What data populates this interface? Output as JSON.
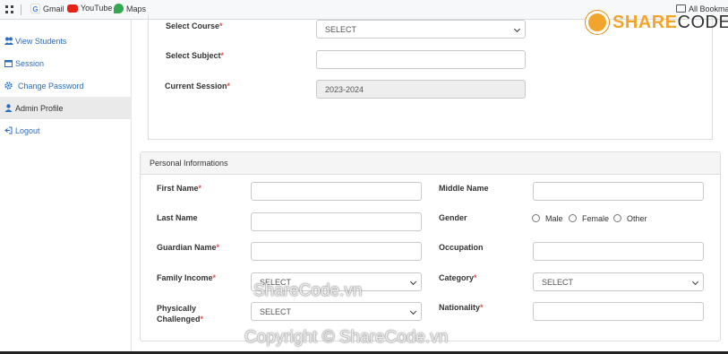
{
  "bookmarks": {
    "items": [
      {
        "label": "Gmail",
        "icon": "google-icon"
      },
      {
        "label": "YouTube",
        "icon": "youtube-icon"
      },
      {
        "label": "Maps",
        "icon": "maps-icon"
      }
    ],
    "all_label": "All Bookmark"
  },
  "logo": {
    "part1": "SHARE",
    "part2": "CODE.vn"
  },
  "sidebar": {
    "items": [
      {
        "label": "View Students",
        "icon": "users-icon"
      },
      {
        "label": "Session",
        "icon": "calendar-icon"
      },
      {
        "label": "Change Password",
        "icon": "gear-icon"
      },
      {
        "label": "Admin Profile",
        "icon": "user-icon"
      },
      {
        "label": "Logout",
        "icon": "logout-icon"
      }
    ]
  },
  "course_form": {
    "select_course_label": "Select Course",
    "select_course_value": "SELECT",
    "select_subject_label": "Select Subject",
    "select_subject_value": "",
    "current_session_label": "Current Session",
    "current_session_value": "2023-2024",
    "required_mark": "*"
  },
  "personal": {
    "heading": "Personal Informations",
    "first_name_label": "First Name",
    "middle_name_label": "Middle Name",
    "last_name_label": "Last Name",
    "gender_label": "Gender",
    "gender_options": [
      "Male",
      "Female",
      "Other"
    ],
    "guardian_name_label": "Guardian Name",
    "occupation_label": "Occupation",
    "family_income_label": "Family Income",
    "family_income_value": "SELECT",
    "category_label": "Category",
    "category_value": "SELECT",
    "physically_label_line1": "Physically",
    "physically_label_line2": "Challenged",
    "physically_value": "SELECT",
    "nationality_label": "Nationality"
  },
  "watermarks": {
    "mid": "ShareCode.vn",
    "bottom": "Copyright © ShareCode.vn"
  }
}
